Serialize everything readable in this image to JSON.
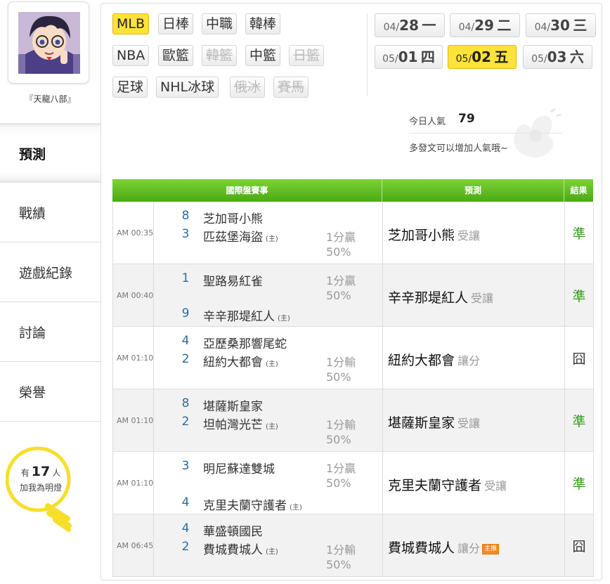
{
  "user": {
    "name": "『天龍八部』"
  },
  "nav": [
    {
      "label": "預測",
      "active": true
    },
    {
      "label": "戰績"
    },
    {
      "label": "遊戲紀錄"
    },
    {
      "label": "討論"
    },
    {
      "label": "榮譽"
    }
  ],
  "fans": {
    "prefix": "有",
    "count": "17",
    "suffix": "人",
    "line2": "加我為明燈"
  },
  "sports": {
    "mlb": "MLB",
    "jpb": "日棒",
    "cpbl": "中職",
    "kbo": "韓棒",
    "nba": "NBA",
    "euro": "歐籃",
    "kbl": "韓籃",
    "cba": "中籃",
    "jbl": "日籃",
    "soccer": "足球",
    "nhl": "NHL冰球",
    "khl": "俄冰",
    "horse": "賽馬"
  },
  "dates": [
    {
      "prefix": "04/",
      "day": "28",
      "weekday": "一"
    },
    {
      "prefix": "04/",
      "day": "29",
      "weekday": "二"
    },
    {
      "prefix": "04/",
      "day": "30",
      "weekday": "三"
    },
    {
      "prefix": "05/",
      "day": "01",
      "weekday": "四"
    },
    {
      "prefix": "05/",
      "day": "02",
      "weekday": "五",
      "active": true
    },
    {
      "prefix": "05/",
      "day": "03",
      "weekday": "六"
    }
  ],
  "popularity": {
    "label": "今日人氣",
    "value": "79",
    "note": "多發文可以增加人氣哦~"
  },
  "table": {
    "headers": {
      "match": "國際盤賽事",
      "prediction": "預測",
      "result": "結果"
    },
    "host_mark": "(主)",
    "rows": [
      {
        "time": "AM 00:35",
        "away_score": "8",
        "away": "芝加哥小熊",
        "home_score": "3",
        "home": "匹茲堡海盜",
        "spread_pos": "home",
        "spread": "1分贏",
        "pct": "50%",
        "pick": "芝加哥小熊",
        "pick_note": "受讓",
        "tag": "",
        "result": "準",
        "hit": true
      },
      {
        "time": "AM 00:40",
        "away_score": "1",
        "away": "聖路易紅雀",
        "home_score": "9",
        "home": "辛辛那堤紅人",
        "spread_pos": "away",
        "spread": "1分贏",
        "pct": "50%",
        "pick": "辛辛那堤紅人",
        "pick_note": "受讓",
        "tag": "",
        "result": "準",
        "hit": true
      },
      {
        "time": "AM 01:10",
        "away_score": "4",
        "away": "亞歷桑那響尾蛇",
        "home_score": "2",
        "home": "紐約大都會",
        "spread_pos": "home",
        "spread": "1分輸",
        "pct": "50%",
        "pick": "紐約大都會",
        "pick_note": "讓分",
        "tag": "",
        "result": "囧",
        "hit": false
      },
      {
        "time": "AM 01:10",
        "away_score": "8",
        "away": "堪薩斯皇家",
        "home_score": "2",
        "home": "坦帕灣光芒",
        "spread_pos": "home",
        "spread": "1分輸",
        "pct": "50%",
        "pick": "堪薩斯皇家",
        "pick_note": "受讓",
        "tag": "",
        "result": "準",
        "hit": true
      },
      {
        "time": "AM 01:10",
        "away_score": "3",
        "away": "明尼蘇達雙城",
        "home_score": "4",
        "home": "克里夫蘭守護者",
        "spread_pos": "away",
        "spread": "1分贏",
        "pct": "50%",
        "pick": "克里夫蘭守護者",
        "pick_note": "受讓",
        "tag": "",
        "result": "準",
        "hit": true
      },
      {
        "time": "AM 06:45",
        "away_score": "4",
        "away": "華盛頓國民",
        "home_score": "2",
        "home": "費城費城人",
        "spread_pos": "home",
        "spread": "1分輸",
        "pct": "50%",
        "pick": "費城費城人",
        "pick_note": "讓分",
        "tag": "主推",
        "result": "囧",
        "hit": false
      }
    ]
  }
}
